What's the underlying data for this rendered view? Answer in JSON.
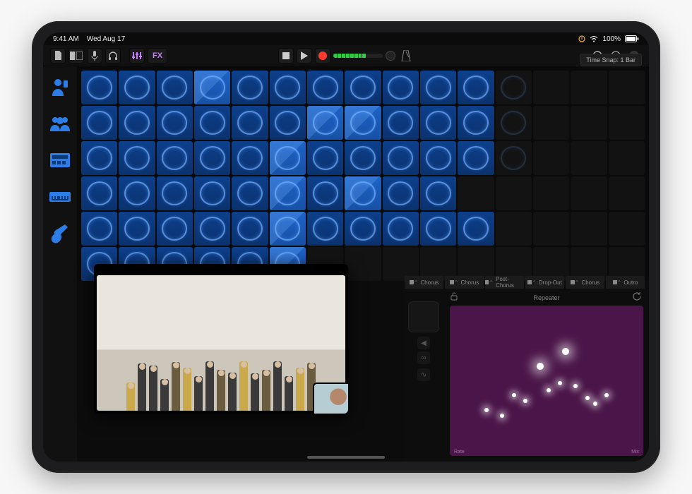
{
  "status": {
    "time": "9:41 AM",
    "date": "Wed Aug 17",
    "battery": "100%"
  },
  "toolbar": {
    "fx_label": "FX",
    "time_snap": "Time Snap: 1 Bar"
  },
  "sidebar": {
    "items": [
      {
        "name": "solo-user"
      },
      {
        "name": "group-users"
      },
      {
        "name": "drum-machine"
      },
      {
        "name": "keyboard"
      },
      {
        "name": "guitar"
      }
    ]
  },
  "grid": {
    "rows": 6,
    "cols": 15,
    "filled_cols_per_row": [
      11,
      11,
      11,
      10,
      11,
      6
    ],
    "wave_cols": [
      12,
      13
    ]
  },
  "sections": {
    "labels": [
      "Chorus",
      "Chorus",
      "Post-Chorus",
      "Drop-Out",
      "Chorus",
      "Outro"
    ]
  },
  "repeater": {
    "title": "Repeater",
    "lock": "unlocked",
    "axis_left": "Rate",
    "axis_right": "Mix"
  },
  "pip": {
    "type": "facetime-overlay",
    "people_count": 17
  }
}
